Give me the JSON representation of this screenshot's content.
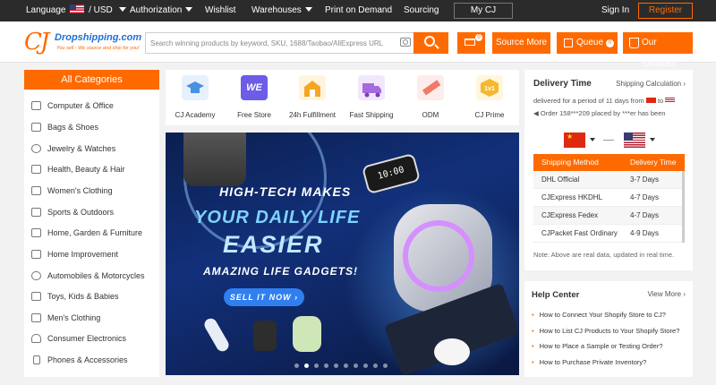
{
  "topbar": {
    "language_label": "Language",
    "currency": "/ USD",
    "authorization": "Authorization",
    "wishlist": "Wishlist",
    "warehouses": "Warehouses",
    "print_on_demand": "Print on Demand",
    "sourcing": "Sourcing",
    "my_cj": "My CJ",
    "sign_in": "Sign In",
    "register": "Register"
  },
  "header": {
    "logo_mark": "CJ",
    "logo_name": "Dropshipping.com",
    "logo_tagline": "You sell - We source and ship for you!",
    "search_placeholder": "Search winning products by keyword, SKU, 1688/Taobao/AliExpress URL",
    "cart_count": "0",
    "source_more": "Source More",
    "queue": "Queue",
    "queue_count": "0",
    "our_services": "Our Services"
  },
  "categories": {
    "title": "All Categories",
    "items": [
      "Computer & Office",
      "Bags & Shoes",
      "Jewelry & Watches",
      "Health, Beauty & Hair",
      "Women's Clothing",
      "Sports & Outdoors",
      "Home, Garden & Furniture",
      "Home Improvement",
      "Automobiles & Motorcycles",
      "Toys, Kids & Babies",
      "Men's Clothing",
      "Consumer Electronics",
      "Phones & Accessories"
    ]
  },
  "features": [
    {
      "label": "CJ Academy",
      "icon": "graduation-cap-icon",
      "color": "#4a90e2"
    },
    {
      "label": "Free Store",
      "icon": "we-store-icon",
      "color": "#6c5ce7"
    },
    {
      "label": "24h Fulfillment",
      "icon": "warehouse-icon",
      "color": "#f5a623"
    },
    {
      "label": "Fast Shipping",
      "icon": "truck-icon",
      "color": "#a66bde"
    },
    {
      "label": "ODM",
      "icon": "ruler-icon",
      "color": "#f07a6a"
    },
    {
      "label": "CJ Prime",
      "icon": "prime-badge-icon",
      "color": "#f5b82e"
    }
  ],
  "banner": {
    "line1": "HIGH-TECH MAKES",
    "line2": "YOUR DAILY LIFE",
    "line3": "EASIER",
    "line4": "AMAZING LIFE GADGETS!",
    "cta": "SELL IT NOW",
    "clock_text": "10:00",
    "slide_count": 10,
    "active_slide": 2
  },
  "delivery": {
    "title": "Delivery Time",
    "link": "Shipping Calculation",
    "line1": "delivered for a period of 11 days from",
    "line1_to": "to",
    "line2": "Order 158***209 placed by ***er has been",
    "from_flag": "CN",
    "to_flag": "US",
    "table_headers": [
      "Shipping Method",
      "Delivery Time"
    ],
    "rows": [
      {
        "method": "DHL Official",
        "time": "3-7 Days"
      },
      {
        "method": "CJExpress HKDHL",
        "time": "4-7 Days"
      },
      {
        "method": "CJExpress Fedex",
        "time": "4-7 Days"
      },
      {
        "method": "CJPacket Fast Ordinary",
        "time": "4-9 Days"
      }
    ],
    "note": "Note: Above are real data, updated in real time."
  },
  "help": {
    "title": "Help Center",
    "more": "View More",
    "items": [
      "How to Connect Your Shopify Store to CJ?",
      "How to List CJ Products to Your Shopify Store?",
      "How to Place a Sample or Testing Order?",
      "How to Purchase Private Inventory?"
    ]
  },
  "colors": {
    "accent": "#ff6a00",
    "topbar": "#2b2b2b",
    "link_blue": "#1f6fd6"
  }
}
